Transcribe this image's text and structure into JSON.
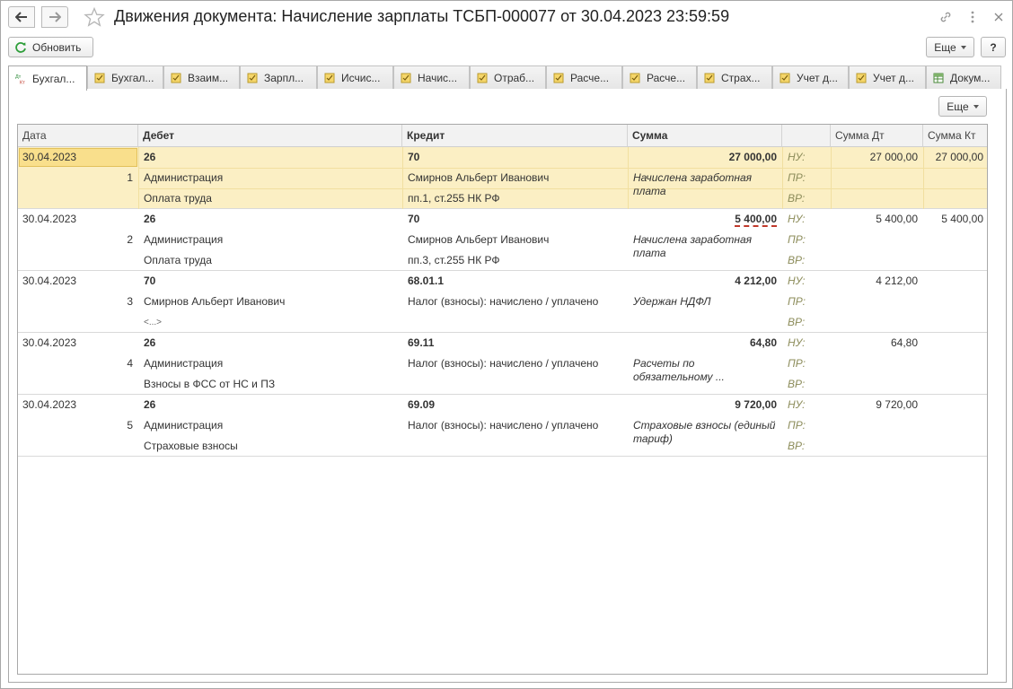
{
  "window": {
    "title": "Движения документа: Начисление зарплаты ТСБП-000077 от 30.04.2023 23:59:59"
  },
  "toolbar": {
    "refresh_label": "Обновить",
    "more_label": "Еще",
    "help_label": "?"
  },
  "tabs": [
    {
      "label": "Бухгал...",
      "icon": "accounting-dt-kt-icon",
      "active": true
    },
    {
      "label": "Бухгал...",
      "icon": "register-icon"
    },
    {
      "label": "Взаим...",
      "icon": "register-icon"
    },
    {
      "label": "Зарпл...",
      "icon": "register-icon"
    },
    {
      "label": "Исчис...",
      "icon": "register-icon"
    },
    {
      "label": "Начис...",
      "icon": "register-icon"
    },
    {
      "label": "Отраб...",
      "icon": "register-icon"
    },
    {
      "label": "Расче...",
      "icon": "register-icon"
    },
    {
      "label": "Расче...",
      "icon": "register-icon"
    },
    {
      "label": "Страх...",
      "icon": "register-icon"
    },
    {
      "label": "Учет д...",
      "icon": "register-icon"
    },
    {
      "label": "Учет д...",
      "icon": "register-icon"
    },
    {
      "label": "Докум...",
      "icon": "table-icon"
    }
  ],
  "grid": {
    "more_label": "Еще",
    "columns": {
      "date": "Дата",
      "debit": "Дебет",
      "credit": "Кредит",
      "sum": "Сумма",
      "sum_dt": "Сумма Дт",
      "sum_kt": "Сумма Кт"
    },
    "tax_labels": {
      "nu": "НУ:",
      "pr": "ПР:",
      "vr": "ВР:"
    },
    "rows": [
      {
        "date": "30.04.2023",
        "num": "1",
        "debit": "26",
        "debit_sub1": "Администрация",
        "debit_sub2": "Оплата труда",
        "credit": "70",
        "credit_sub1": "Смирнов Альберт Иванович",
        "credit_sub2": "пп.1, ст.255 НК РФ",
        "sum": "27 000,00",
        "memo": "Начислена заработная плата",
        "sum_dt": "27 000,00",
        "sum_kt": "27 000,00"
      },
      {
        "date": "30.04.2023",
        "num": "2",
        "debit": "26",
        "debit_sub1": "Администрация",
        "debit_sub2": "Оплата труда",
        "credit": "70",
        "credit_sub1": "Смирнов Альберт Иванович",
        "credit_sub2": "пп.3, ст.255 НК РФ",
        "sum": "5 400,00",
        "memo": "Начислена заработная плата",
        "sum_dt": "5 400,00",
        "sum_kt": "5 400,00"
      },
      {
        "date": "30.04.2023",
        "num": "3",
        "debit": "70",
        "debit_sub1": "Смирнов Альберт Иванович",
        "debit_sub2": "<...>",
        "credit": "68.01.1",
        "credit_sub1": "Налог (взносы): начислено / уплачено",
        "credit_sub2": "",
        "sum": "4 212,00",
        "memo": "Удержан НДФЛ",
        "sum_dt": "4 212,00",
        "sum_kt": ""
      },
      {
        "date": "30.04.2023",
        "num": "4",
        "debit": "26",
        "debit_sub1": "Администрация",
        "debit_sub2": "Взносы в ФСС от НС и ПЗ",
        "credit": "69.11",
        "credit_sub1": "Налог (взносы): начислено / уплачено",
        "credit_sub2": "",
        "sum": "64,80",
        "memo": "Расчеты по обязательному ...",
        "sum_dt": "64,80",
        "sum_kt": ""
      },
      {
        "date": "30.04.2023",
        "num": "5",
        "debit": "26",
        "debit_sub1": "Администрация",
        "debit_sub2": "Страховые взносы",
        "credit": "69.09",
        "credit_sub1": "Налог (взносы): начислено / уплачено",
        "credit_sub2": "",
        "sum": "9 720,00",
        "memo": "Страховые взносы (единый тариф)",
        "sum_dt": "9 720,00",
        "sum_kt": ""
      }
    ]
  }
}
